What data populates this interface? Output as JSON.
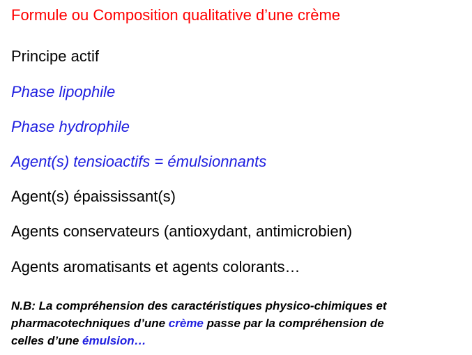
{
  "title": {
    "text": "Formule ou Composition qualitative d’une crème",
    "color": "#ff0000"
  },
  "items": [
    {
      "text": "Principe actif",
      "color": "#000000",
      "italic": false
    },
    {
      "text": "Phase lipophile",
      "color": "#2020e0",
      "italic": true
    },
    {
      "text": "Phase hydrophile",
      "color": "#2020e0",
      "italic": true
    },
    {
      "text": "Agent(s) tensioactifs = émulsionnants",
      "color": "#2020e0",
      "italic": true
    },
    {
      "text": "Agent(s) épaississant(s)",
      "color": "#000000",
      "italic": false
    },
    {
      "text": "Agents conservateurs (antioxydant, antimicrobien)",
      "color": "#000000",
      "italic": false
    },
    {
      "text": "Agents aromatisants et agents colorants…",
      "color": "#000000",
      "italic": false
    }
  ],
  "note": {
    "line1": "N.B: La compréhension des caractéristiques physico-chimiques et",
    "line2_before": "pharmacotechniques d’une ",
    "line2_highlight": "crème",
    "line2_after": " passe par la compréhension de",
    "line3_before": "celles  d’une ",
    "line3_highlight": "émulsion…",
    "text_color": "#000000",
    "highlight_color": "#2020e0"
  }
}
